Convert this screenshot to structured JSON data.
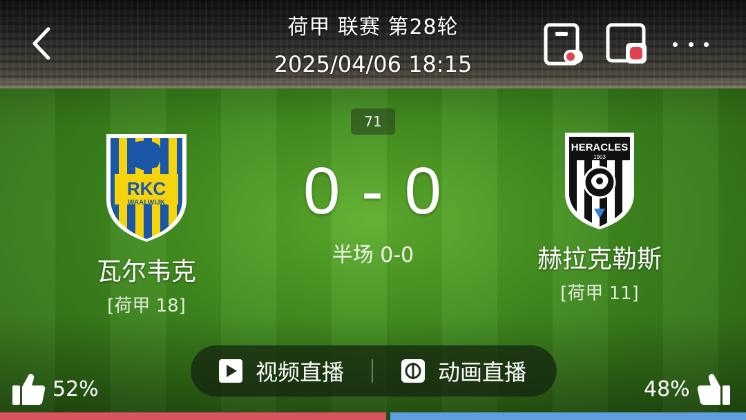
{
  "header": {
    "title": "荷甲 联赛 第28轮",
    "datetime": "2025/04/06 18:15",
    "icons": {
      "back": "chevron-left-icon",
      "pip": "picture-in-picture-icon",
      "float": "floating-window-icon",
      "more": "more-dots-icon"
    }
  },
  "match": {
    "minute": "71",
    "score": "0 - 0",
    "halftime": "半场 0-0"
  },
  "home": {
    "name": "瓦尔韦克",
    "rank": "[荷甲 18]",
    "crest_text": "RKC",
    "crest_subtext": "WAALWIJK",
    "crest_colors": {
      "primary": "#f5d40c",
      "secondary": "#1b57a6"
    }
  },
  "away": {
    "name": "赫拉克勒斯",
    "rank": "[荷甲 11]",
    "crest_text": "HERACLES",
    "crest_year": "1903",
    "crest_colors": {
      "primary": "#111111",
      "secondary": "#ffffff",
      "accent": "#3a7fd0"
    }
  },
  "live": {
    "video_label": "视频直播",
    "video_icon": "play-icon",
    "animation_label": "动画直播",
    "animation_icon": "animation-live-icon"
  },
  "votes": {
    "home_percent_label": "52%",
    "away_percent_label": "48%",
    "home_share": 0.52,
    "away_share": 0.48,
    "home_color": "#d9545c",
    "away_color": "#5f9fe0"
  }
}
